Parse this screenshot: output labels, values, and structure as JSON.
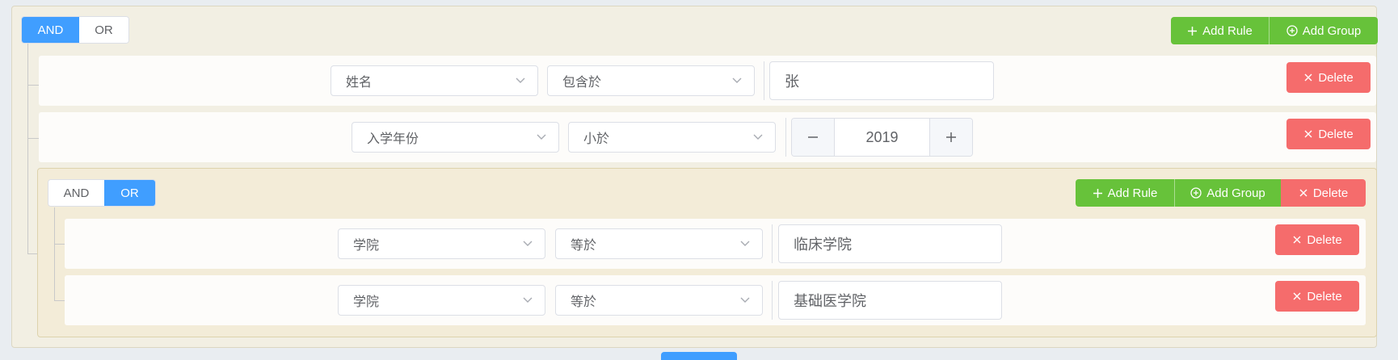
{
  "root_group": {
    "conjunction": {
      "and_label": "AND",
      "or_label": "OR",
      "selected": "AND"
    },
    "add_rule_label": "Add Rule",
    "add_group_label": "Add Group",
    "rules": [
      {
        "field": "姓名",
        "operator": "包含於",
        "value": "张",
        "delete_label": "Delete"
      },
      {
        "field": "入学年份",
        "operator": "小於",
        "value": "2019",
        "delete_label": "Delete"
      }
    ],
    "nested_group": {
      "conjunction": {
        "and_label": "AND",
        "or_label": "OR",
        "selected": "OR"
      },
      "add_rule_label": "Add Rule",
      "add_group_label": "Add Group",
      "delete_label": "Delete",
      "rules": [
        {
          "field": "学院",
          "operator": "等於",
          "value": "临床学院",
          "delete_label": "Delete"
        },
        {
          "field": "学院",
          "operator": "等於",
          "value": "基础医学院",
          "delete_label": "Delete"
        }
      ]
    }
  },
  "colors": {
    "primary": "#409eff",
    "success": "#67c23a",
    "danger": "#f56c6c",
    "group_bg": "#f2efe3",
    "nested_bg": "#f3ecd8"
  }
}
